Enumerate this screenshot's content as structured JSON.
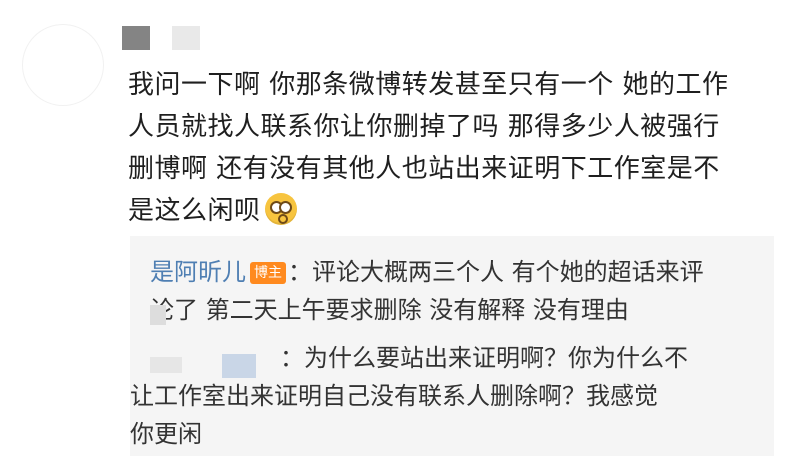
{
  "comment": {
    "lines": [
      "我问一下啊 你那条微博转发甚至只有一个 她的工作",
      "人员就找人联系你让你删掉了吗 那得多少人被强行",
      "删博啊 还有没有其他人也站出来证明下工作室是不",
      "是这么闲呗"
    ],
    "emoji": "dizzy-face-emoji"
  },
  "reply1": {
    "author": "是阿昕儿",
    "badge": "博主",
    "line1": "：评论大概两三个人 有个她的超话来评",
    "line2": "论了 第二天上午要求删除 没有解释 没有理由"
  },
  "reply2": {
    "line1": "：为什么要站出来证明啊？你为什么不",
    "line2": "让工作室出来证明自己没有联系人删除啊？我感觉",
    "line3": "你更闲"
  }
}
